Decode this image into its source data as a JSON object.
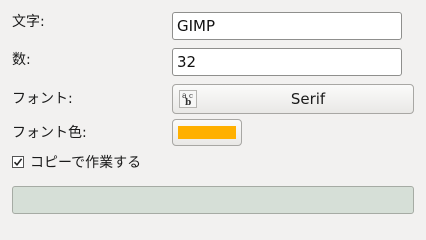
{
  "form": {
    "text_label": "文字:",
    "text_value": "GIMP",
    "number_label": "数:",
    "number_value": "32",
    "font_label": "フォント:",
    "font_value": "Serif",
    "font_color_label": "フォント色:",
    "font_color": "#ffb000",
    "work_on_copy_label": "コピーで作業する",
    "work_on_copy_checked": true
  },
  "progress": {
    "fraction": 0
  }
}
